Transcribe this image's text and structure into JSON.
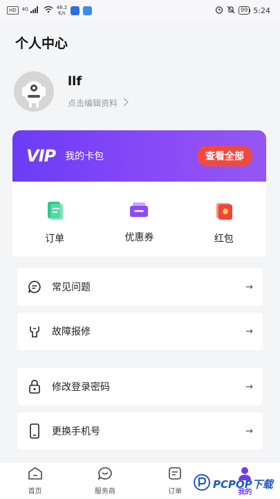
{
  "status_bar": {
    "network_chip": "HD",
    "signal_label": "4G",
    "speed_value": "46.2",
    "speed_unit": "K/s",
    "battery": "99",
    "time": "5:24"
  },
  "header": {
    "title": "个人中心"
  },
  "profile": {
    "username": "llf",
    "edit_link": "点击编辑资料"
  },
  "vip_card": {
    "logo": "VIP",
    "title": "我的卡包",
    "view_all": "查看全部"
  },
  "quick_actions": [
    {
      "label": "订单",
      "icon": "order-doc-icon"
    },
    {
      "label": "优惠券",
      "icon": "coupon-icon"
    },
    {
      "label": "红包",
      "icon": "red-envelope-icon"
    }
  ],
  "menu": [
    {
      "label": "常见问题",
      "icon": "faq-bubble-icon"
    },
    {
      "label": "故障报修",
      "icon": "repair-wrench-icon"
    },
    {
      "label": "修改登录密码",
      "icon": "lock-icon"
    },
    {
      "label": "更换手机号",
      "icon": "phone-icon"
    }
  ],
  "bottom_nav": [
    {
      "label": "首页",
      "icon": "home-icon"
    },
    {
      "label": "服务商",
      "icon": "chat-icon"
    },
    {
      "label": "订单",
      "icon": "order-icon"
    },
    {
      "label": "我的",
      "icon": "profile-icon",
      "active": true
    }
  ],
  "watermark": {
    "text": "PCPOP下载"
  },
  "colors": {
    "accent": "#6b3cf5",
    "vip_button": "#ef4a42",
    "background": "#f4f5f7"
  }
}
